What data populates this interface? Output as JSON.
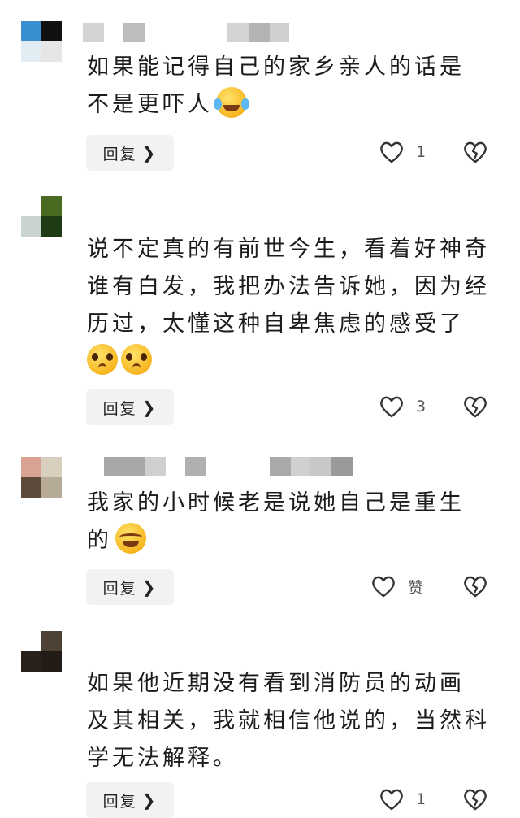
{
  "comments": [
    {
      "avatar_colors": [
        "#3a8fd0",
        "#111111",
        "#e2ecf3",
        "#e6e6e6"
      ],
      "lines": [
        "如果能记得自己的家乡亲人的话是",
        "不是更吓人"
      ],
      "emoji": [
        "laugh-emoji"
      ],
      "reply_label": "回复",
      "like_count": "1"
    },
    {
      "avatar_colors": [
        "#ffffff",
        "#4a6a22",
        "#c9d3cf",
        "#1f3b16"
      ],
      "lines": [
        "说不定真的有前世今生，看着好神奇",
        "谁有白发，我把办法告诉她，因为经",
        "历过，太懂这种自卑焦虑的感受了"
      ],
      "emoji": [
        "pleading-emoji",
        "pleading-emoji"
      ],
      "reply_label": "回复",
      "like_count": "3"
    },
    {
      "avatar_colors": [
        "#d9a394",
        "#d8cfbf",
        "#5d4a3b",
        "#b5ab96"
      ],
      "lines": [
        "我家的小时候老是说她自己是重生",
        "的"
      ],
      "emoji": [
        "crying-laughing-emoji"
      ],
      "reply_label": "回复",
      "like_count": "赞"
    },
    {
      "avatar_colors": [
        "#ffffff",
        "#4e4236",
        "#2b211b",
        "#231b16"
      ],
      "lines": [
        "如果他近期没有看到消防员的动画",
        "及其相关，我就相信他说的，当然科",
        "学无法解释。"
      ],
      "emoji": [],
      "reply_label": "回复",
      "like_count": "1"
    }
  ]
}
